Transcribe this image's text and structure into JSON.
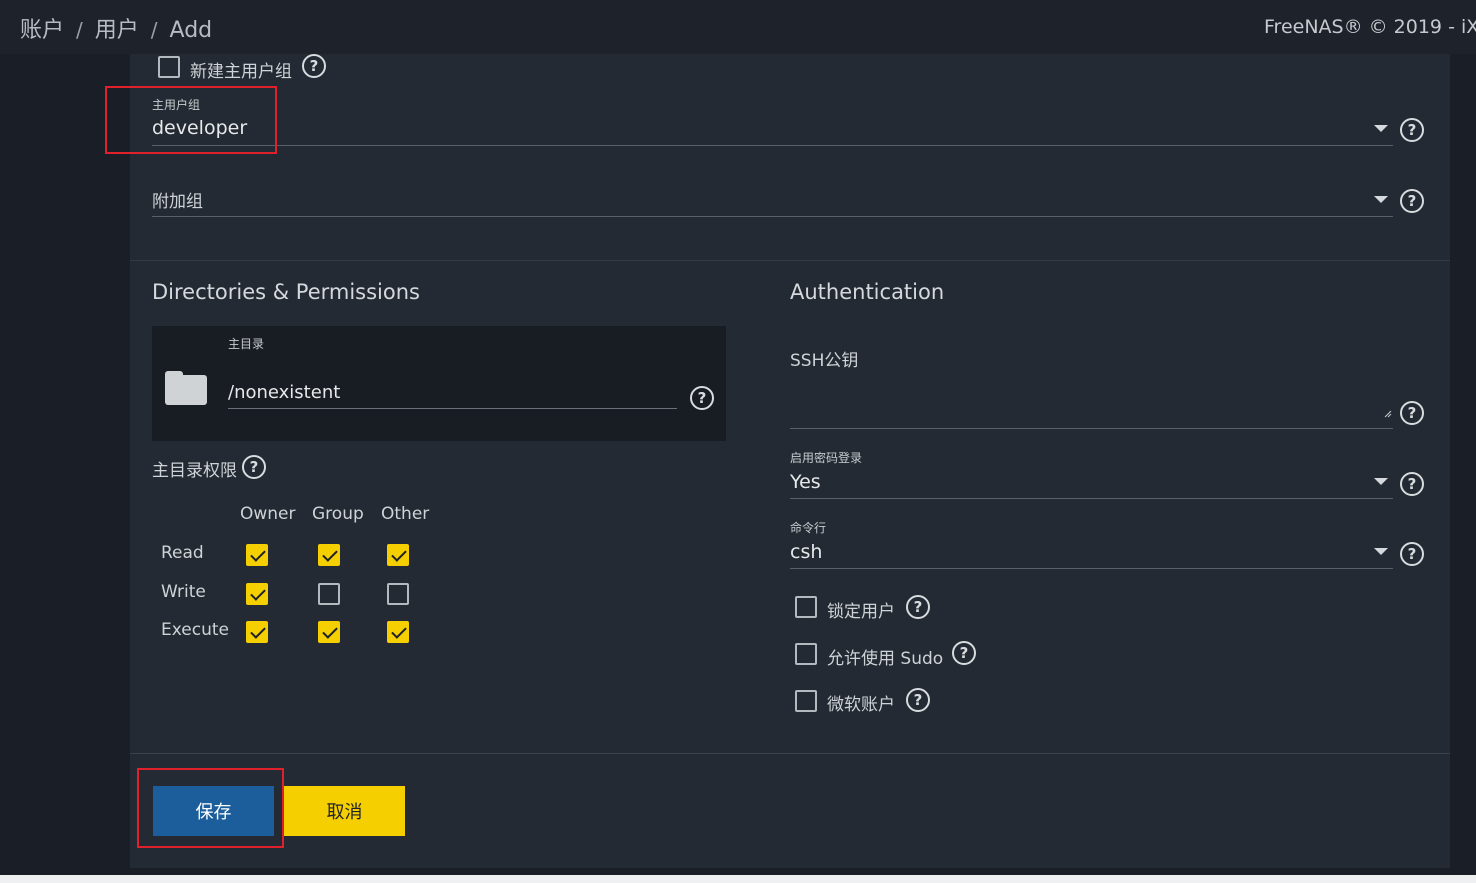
{
  "breadcrumb": {
    "items": [
      "账户",
      "用户",
      "Add"
    ],
    "sep": "/"
  },
  "copyright": "FreeNAS® © 2019 - iX",
  "new_primary_group": {
    "label": "新建主用户组",
    "checked": false
  },
  "primary_group": {
    "label": "主用户组",
    "value": "developer"
  },
  "aux_groups": {
    "label": "附加组",
    "value": ""
  },
  "dirs": {
    "title": "Directories & Permissions",
    "home_label": "主目录",
    "home_value": "/nonexistent",
    "perm_label": "主目录权限",
    "columns": [
      "Owner",
      "Group",
      "Other"
    ],
    "rows": [
      {
        "label": "Read",
        "values": [
          true,
          true,
          true
        ]
      },
      {
        "label": "Write",
        "values": [
          true,
          false,
          false
        ]
      },
      {
        "label": "Execute",
        "values": [
          true,
          true,
          true
        ]
      }
    ]
  },
  "auth": {
    "title": "Authentication",
    "ssh_label": "SSH公钥",
    "ssh_value": "",
    "password_login": {
      "label": "启用密码登录",
      "value": "Yes"
    },
    "shell": {
      "label": "命令行",
      "value": "csh"
    },
    "lock_user": {
      "label": "锁定用户",
      "checked": false
    },
    "sudo": {
      "label": "允许使用 Sudo",
      "checked": false
    },
    "microsoft": {
      "label": "微软账户",
      "checked": false
    }
  },
  "actions": {
    "save": "保存",
    "cancel": "取消"
  },
  "icons": {
    "help": "help-circle-icon",
    "dropdown": "caret-down-icon",
    "folder": "folder-icon"
  },
  "colors": {
    "accent_yellow": "#f6cf00",
    "primary_blue": "#1c5e9c",
    "annotation_red": "#e0202a"
  }
}
